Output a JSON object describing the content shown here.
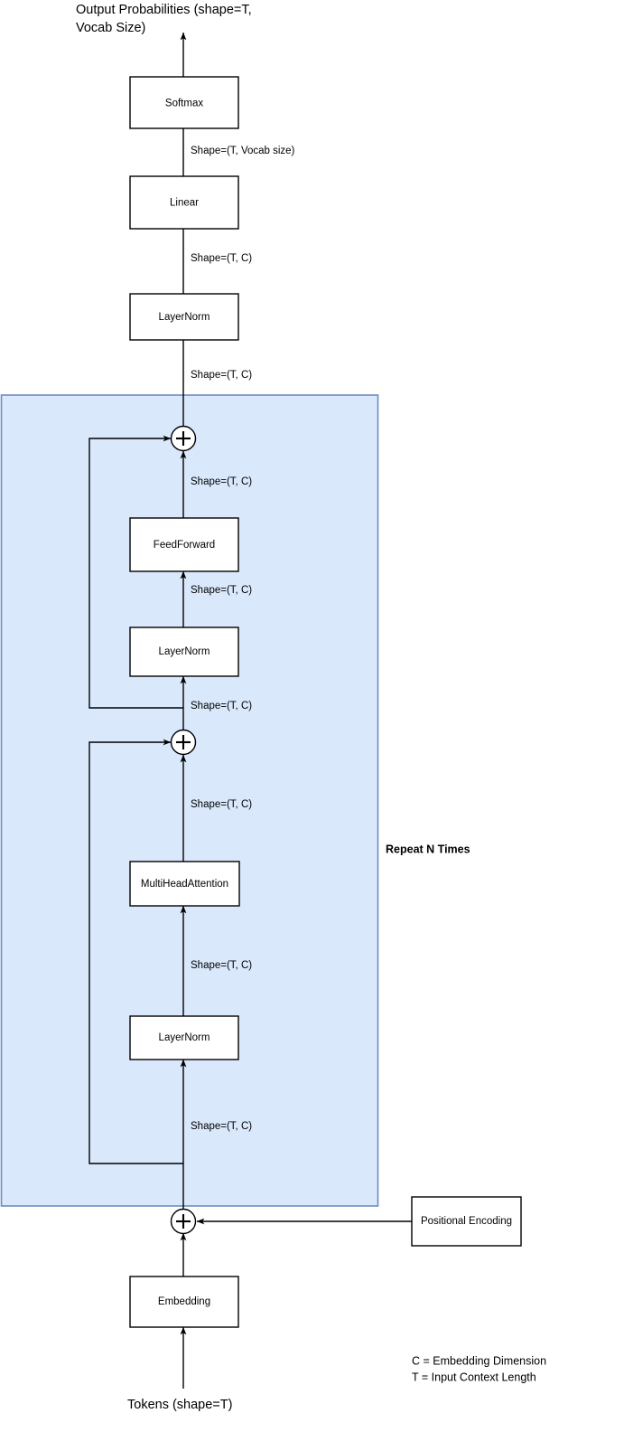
{
  "diagram": {
    "title": "Transformer (decoder-only) architecture block diagram",
    "colors": {
      "group_fill": "#dae8fc",
      "group_stroke": "#6c8ebf",
      "node_fill": "#ffffff",
      "stroke": "#000000",
      "background": "#ffffff"
    },
    "io": {
      "output_line1": "Output Probabilities (shape=T,",
      "output_line2": "Vocab Size)",
      "input": "Tokens (shape=T)"
    },
    "group": {
      "repeat_label": "Repeat N Times"
    },
    "nodes": {
      "softmax": "Softmax",
      "linear": "Linear",
      "layernorm_final": "LayerNorm",
      "feedforward": "FeedForward",
      "layernorm_ff": "LayerNorm",
      "multiheadattention": "MultiHeadAttention",
      "layernorm_attn": "LayerNorm",
      "embedding": "Embedding",
      "positional_encoding": "Positional Encoding",
      "add_ff": "+",
      "add_attn": "+",
      "add_pos": "+"
    },
    "edge_labels": {
      "softmax_in": "Shape=(T, Vocab size)",
      "linear_in": "Shape=(T, C)",
      "layernorm_final_in": "Shape=(T, C)",
      "block_out": "Shape=(T, C)",
      "add_ff_in": "Shape=(T, C)",
      "feedforward_in": "Shape=(T, C)",
      "layernorm_ff_in": "Shape=(T, C)",
      "add_attn_in": "Shape=(T, C)",
      "multihead_in": "Shape=(T, C)",
      "layernorm_attn_in": "Shape=(T, C)"
    },
    "legend": {
      "line1": "C = Embedding Dimension",
      "line2": "T = Input Context Length"
    }
  }
}
